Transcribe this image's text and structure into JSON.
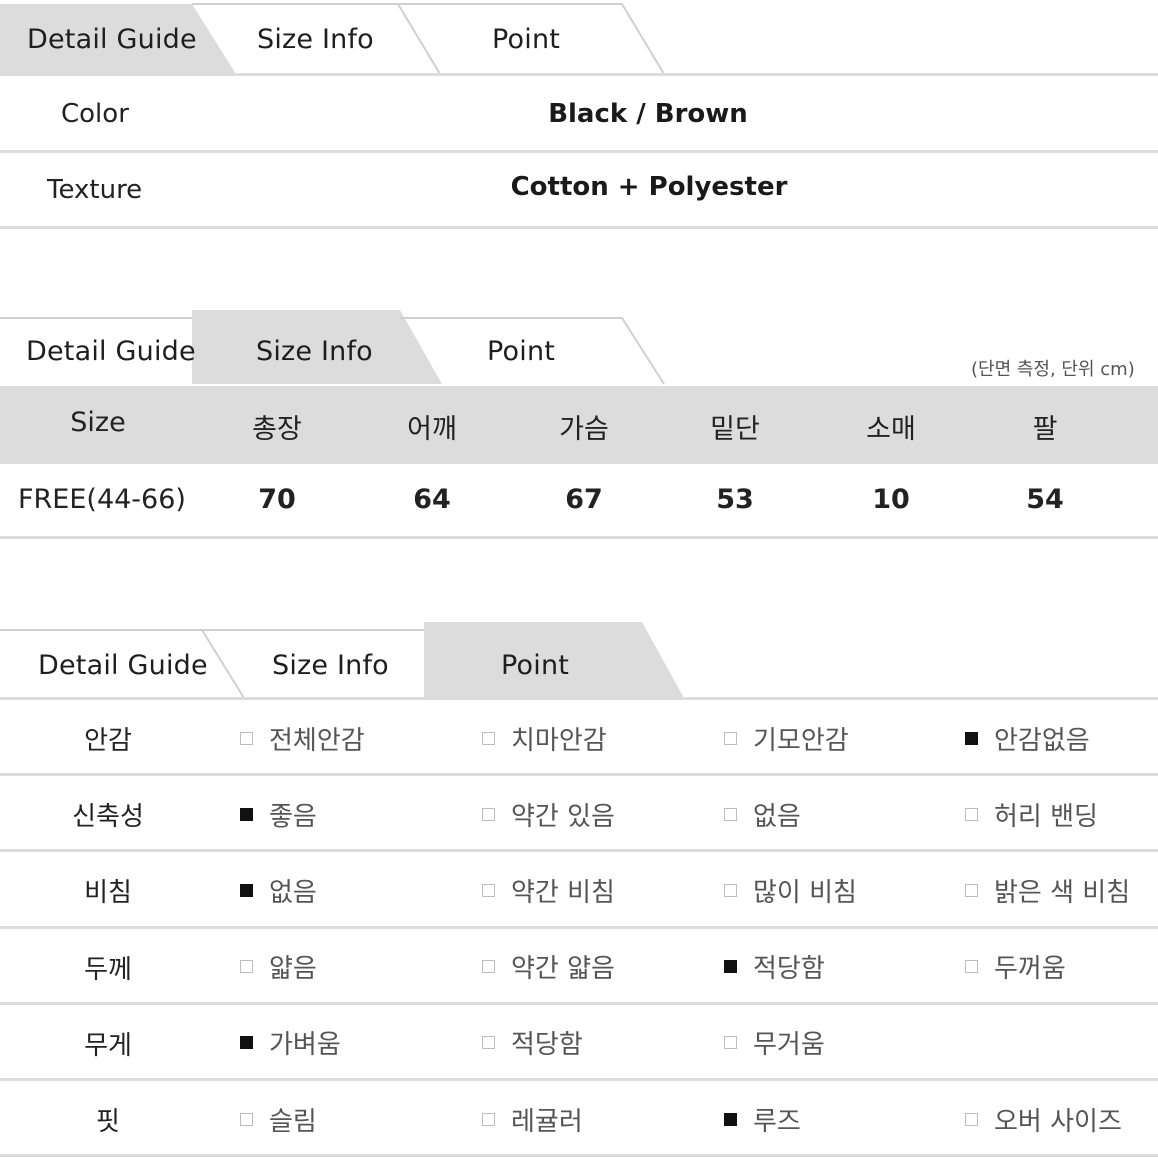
{
  "tabs": [
    "Detail Guide",
    "Size Info",
    "Point"
  ],
  "detail": {
    "rows": [
      {
        "label": "Color",
        "value": "Black / Brown"
      },
      {
        "label": "Texture",
        "value": "Cotton + Polyester"
      }
    ]
  },
  "size": {
    "unit_note": "(단면 측정, 단위 cm)",
    "headers": [
      "Size",
      "총장",
      "어깨",
      "가슴",
      "밑단",
      "소매",
      "팔"
    ],
    "values": [
      "FREE(44-66)",
      "70",
      "64",
      "67",
      "53",
      "10",
      "54"
    ]
  },
  "point": {
    "rows": [
      {
        "label": "안감",
        "options": [
          {
            "text": "전체안감",
            "checked": false
          },
          {
            "text": "치마안감",
            "checked": false
          },
          {
            "text": "기모안감",
            "checked": false
          },
          {
            "text": "안감없음",
            "checked": true
          }
        ]
      },
      {
        "label": "신축성",
        "options": [
          {
            "text": "좋음",
            "checked": true
          },
          {
            "text": "약간 있음",
            "checked": false
          },
          {
            "text": "없음",
            "checked": false
          },
          {
            "text": "허리 밴딩",
            "checked": false
          }
        ]
      },
      {
        "label": "비침",
        "options": [
          {
            "text": "없음",
            "checked": true
          },
          {
            "text": "약간 비침",
            "checked": false
          },
          {
            "text": "많이 비침",
            "checked": false
          },
          {
            "text": "밝은 색 비침",
            "checked": false
          }
        ]
      },
      {
        "label": "두께",
        "options": [
          {
            "text": "얇음",
            "checked": false
          },
          {
            "text": "약간 얇음",
            "checked": false
          },
          {
            "text": "적당함",
            "checked": true
          },
          {
            "text": "두꺼움",
            "checked": false
          }
        ]
      },
      {
        "label": "무게",
        "options": [
          {
            "text": "가벼움",
            "checked": true
          },
          {
            "text": "적당함",
            "checked": false
          },
          {
            "text": "무거움",
            "checked": false
          }
        ]
      },
      {
        "label": "핏",
        "options": [
          {
            "text": "슬림",
            "checked": false
          },
          {
            "text": "레귤러",
            "checked": false
          },
          {
            "text": "루즈",
            "checked": true
          },
          {
            "text": "오버 사이즈",
            "checked": false
          }
        ]
      }
    ]
  },
  "colors": {
    "tab_active": "#dcdcdc",
    "line": "#dcdcdc",
    "check_on": "#111111",
    "check_off": "#bdbdbd"
  }
}
